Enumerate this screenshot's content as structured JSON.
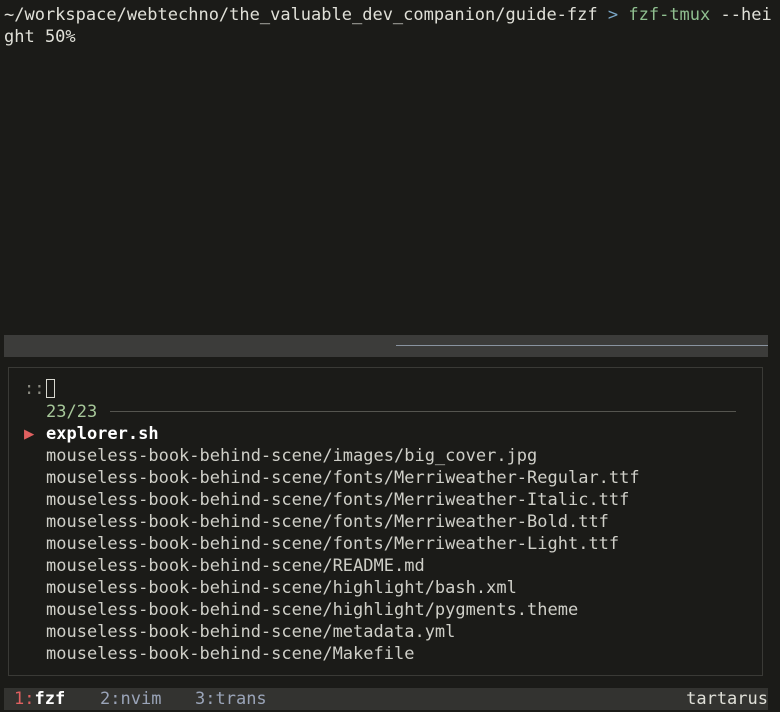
{
  "terminal": {
    "prompt_path": "~/workspace/webtechno/the_valuable_dev_companion/guide-fzf",
    "prompt_symbol": ">",
    "command": "fzf-tmux",
    "command_args": "--height 50%"
  },
  "fzf": {
    "prompt": "::",
    "query": "",
    "match_count": "23/23",
    "pointer": "▶",
    "items": [
      "explorer.sh",
      "mouseless-book-behind-scene/images/big_cover.jpg",
      "mouseless-book-behind-scene/fonts/Merriweather-Regular.ttf",
      "mouseless-book-behind-scene/fonts/Merriweather-Italic.ttf",
      "mouseless-book-behind-scene/fonts/Merriweather-Bold.ttf",
      "mouseless-book-behind-scene/fonts/Merriweather-Light.ttf",
      "mouseless-book-behind-scene/README.md",
      "mouseless-book-behind-scene/highlight/bash.xml",
      "mouseless-book-behind-scene/highlight/pygments.theme",
      "mouseless-book-behind-scene/metadata.yml",
      "mouseless-book-behind-scene/Makefile"
    ],
    "selected_index": 0
  },
  "tmux": {
    "windows": [
      {
        "num": "1:",
        "name": "fzf",
        "active": true
      },
      {
        "num": "2:",
        "name": "nvim",
        "active": false
      },
      {
        "num": "3:",
        "name": "trans",
        "active": false
      }
    ],
    "hostname": "tartarus"
  },
  "colors": {
    "background": "#1b1b18",
    "accent_red": "#e06060",
    "command_green": "#8fbf8f",
    "info_green": "#a7c89a",
    "status_bg": "#333330"
  }
}
